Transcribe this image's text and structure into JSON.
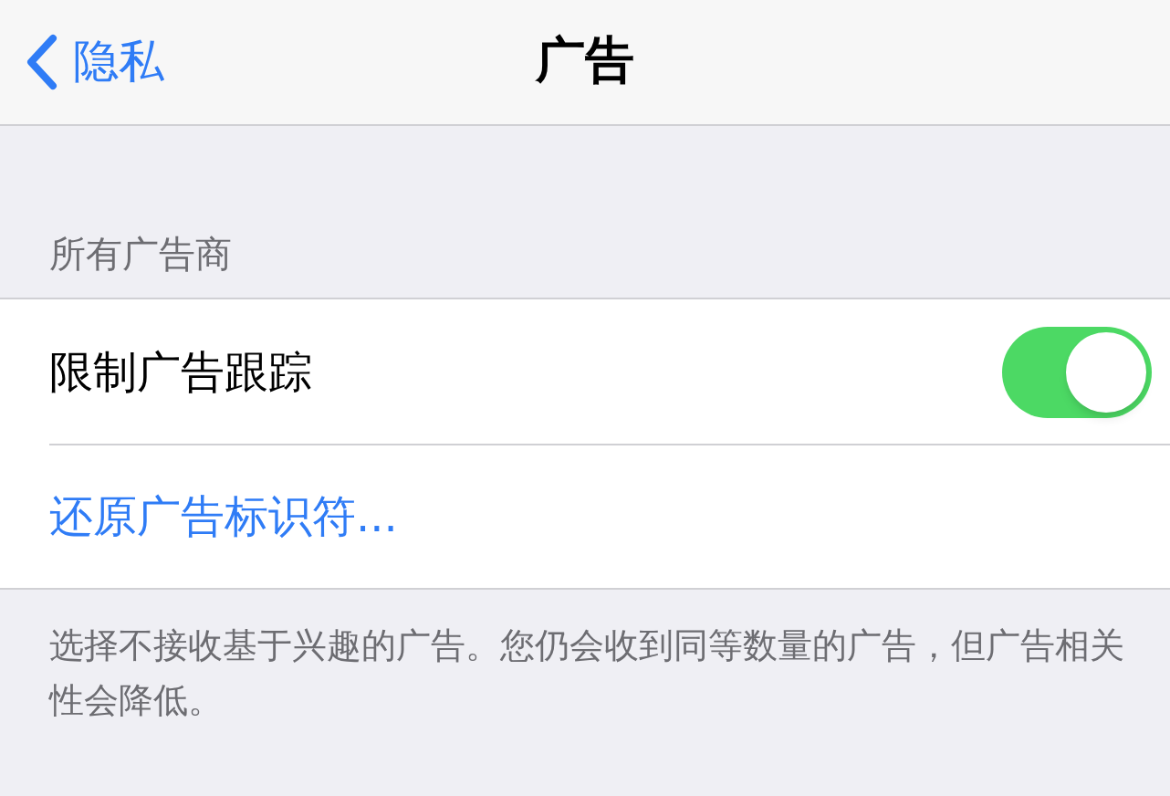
{
  "nav": {
    "back_label": "隐私",
    "title": "广告"
  },
  "section": {
    "header": "所有广告商",
    "rows": [
      {
        "kind": "toggle",
        "label": "限制广告跟踪",
        "on": true
      },
      {
        "kind": "link",
        "label": "还原广告标识符..."
      }
    ],
    "footer": "选择不接收基于兴趣的广告。您仍会收到同等数量的广告，但广告相关性会降低。"
  }
}
